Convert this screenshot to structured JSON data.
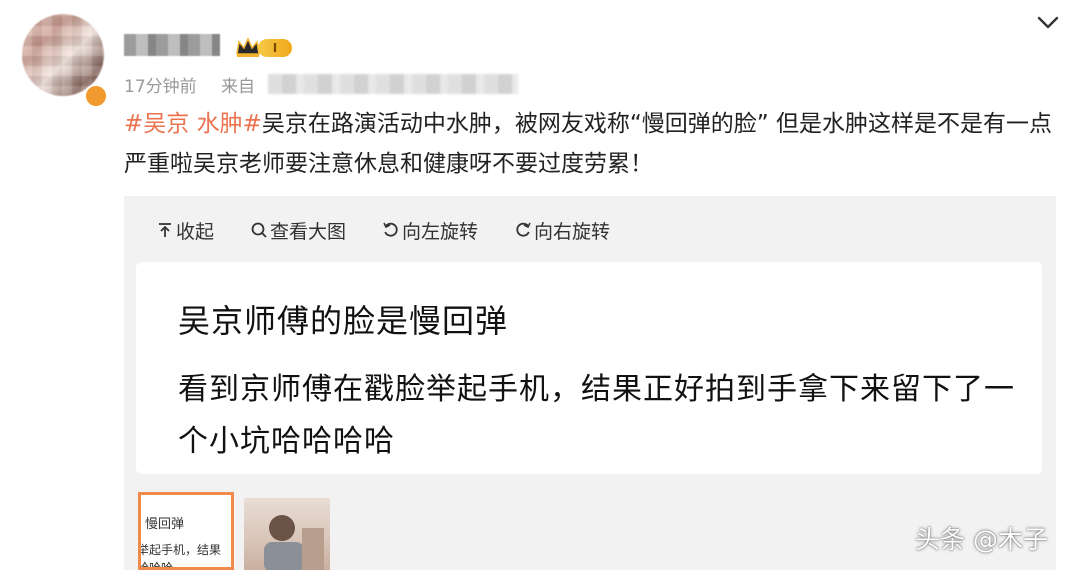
{
  "header": {
    "vip_level": "I",
    "time_ago": "17分钟前",
    "source_prefix": "来自"
  },
  "post": {
    "hashtag": "#吴京 水肿#",
    "text": "吴京在路演活动中水肿，被网友戏称“慢回弹的脸” 但是水肿这样是不是有一点严重啦吴京老师要注意休息和健康呀不要过度劳累！"
  },
  "toolbar": {
    "collapse_label": "收起",
    "view_large_label": "查看大图",
    "rotate_left_label": "向左旋转",
    "rotate_right_label": "向右旋转"
  },
  "image_card": {
    "title": "吴京师傅的脸是慢回弹",
    "body": "看到京师傅在戳脸举起手机，结果正好拍到手拿下来留下了一个小坑哈哈哈哈"
  },
  "thumbnails": {
    "thumb1_line1": "慢回弹",
    "thumb1_line2": "举起手机，结果",
    "thumb1_line3": "哈哈哈"
  },
  "watermark": "头条 @木子",
  "colors": {
    "hashtag": "#eb7350",
    "panel_bg": "#f2f2f2",
    "thumb_border": "#f08a4b",
    "vip_gold": "#f0a818"
  },
  "icons": [
    "chevron-down-icon",
    "crown-icon",
    "verified-icon",
    "collapse-icon",
    "search-icon",
    "rotate-left-icon",
    "rotate-right-icon"
  ]
}
